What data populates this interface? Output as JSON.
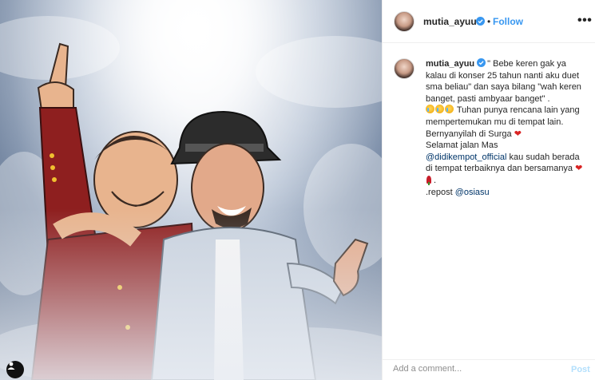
{
  "post": {
    "image_alt": "Illustration of two singers in the clouds",
    "user_tag_icon": "user-tag-icon"
  },
  "header": {
    "username": "mutia_ayuu",
    "separator": "•",
    "follow_label": "Follow",
    "more_label": "•••"
  },
  "caption": {
    "username": "mutia_ayuu",
    "line1": "\" Bebe keren gak ya kalau di konser 25 tahun nanti aku duet sma beliau\" dan saya bilang \"wah keren banget, pasti ambyaar banget\" .",
    "line2": " Tuhan punya rencana lain yang mempertemukan mu di tempat lain.",
    "line3": "Bernyanyilah di Surga",
    "line4": "Selamat jalan Mas",
    "mention1": "@didikempot_official",
    "line5": " kau sudah berada di tempat terbaiknya dan bersamanya",
    "line5_end": " .",
    "line6": ".repost ",
    "mention2": "@osiasu"
  },
  "comment": {
    "placeholder": "Add a comment...",
    "post_label": "Post"
  },
  "colors": {
    "accent": "#3897f0",
    "mention": "#003569",
    "heart": "#d92323"
  }
}
